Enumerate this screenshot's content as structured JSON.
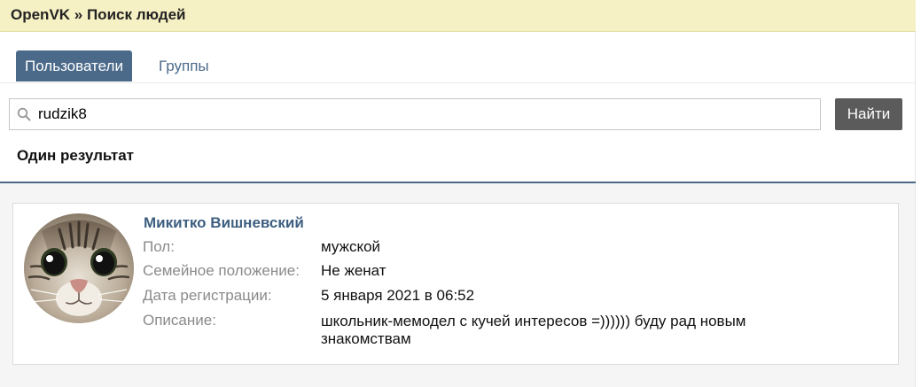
{
  "header": {
    "breadcrumb": "OpenVK » Поиск людей"
  },
  "tabs": [
    {
      "label": "Пользователи",
      "active": true
    },
    {
      "label": "Группы",
      "active": false
    }
  ],
  "search": {
    "value": "rudzik8",
    "button_label": "Найти"
  },
  "result_count": "Один результат",
  "result": {
    "name": "Микитко Вишневский",
    "fields": [
      {
        "label": "Пол:",
        "value": "мужской"
      },
      {
        "label": "Семейное положение:",
        "value": "Не женат"
      },
      {
        "label": "Дата регистрации:",
        "value": "5 января 2021 в 06:52"
      },
      {
        "label": "Описание:",
        "value": "школьник-мемодел с кучей интересов =)))))) буду рад новым знакомствам"
      }
    ]
  },
  "colors": {
    "accent": "#4b6a8a",
    "header_bg": "#f6f1c4",
    "button_bg": "#5b5b5b",
    "name_link": "#3e5f80"
  }
}
